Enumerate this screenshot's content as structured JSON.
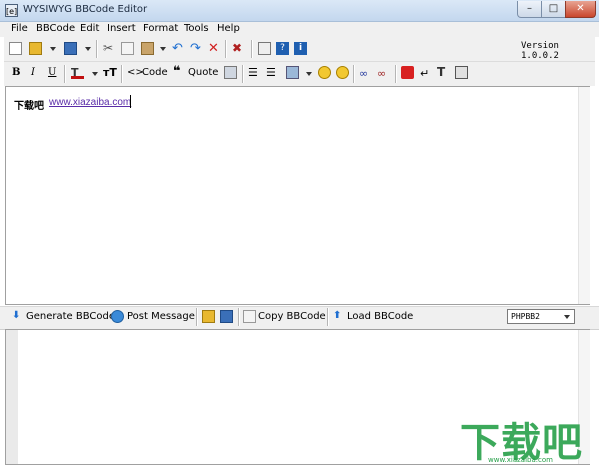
{
  "window": {
    "title": "WYSIWYG BBCode Editor",
    "app_icon": "[e]",
    "minimize": "–",
    "maximize": "□",
    "close": "✕"
  },
  "menu": [
    "File",
    "BBCode",
    "Edit",
    "Insert",
    "Format",
    "Tools",
    "Help"
  ],
  "toolbar1": {
    "version": "Version 1.0.0.2"
  },
  "toolbar2": {
    "bold": "B",
    "italic": "I",
    "underline": "U",
    "font_size_glyph": "тT",
    "code_label": "Code",
    "quote_label": "Quote"
  },
  "editor": {
    "bold_text": "下载吧",
    "link_text": "www.xiazaiba.com"
  },
  "toolbar3": {
    "generate": "Generate BBCode",
    "post": "Post Message",
    "copy": "Copy BBCode",
    "load": "Load BBCode",
    "format_selected": "PHPBB2"
  },
  "watermark": {
    "text": "下载吧",
    "url": "www.xiazaiba.com"
  },
  "colors": {
    "accent": "#1f6fd1",
    "watermark": "#28a04a",
    "link": "#5a2ca8"
  }
}
